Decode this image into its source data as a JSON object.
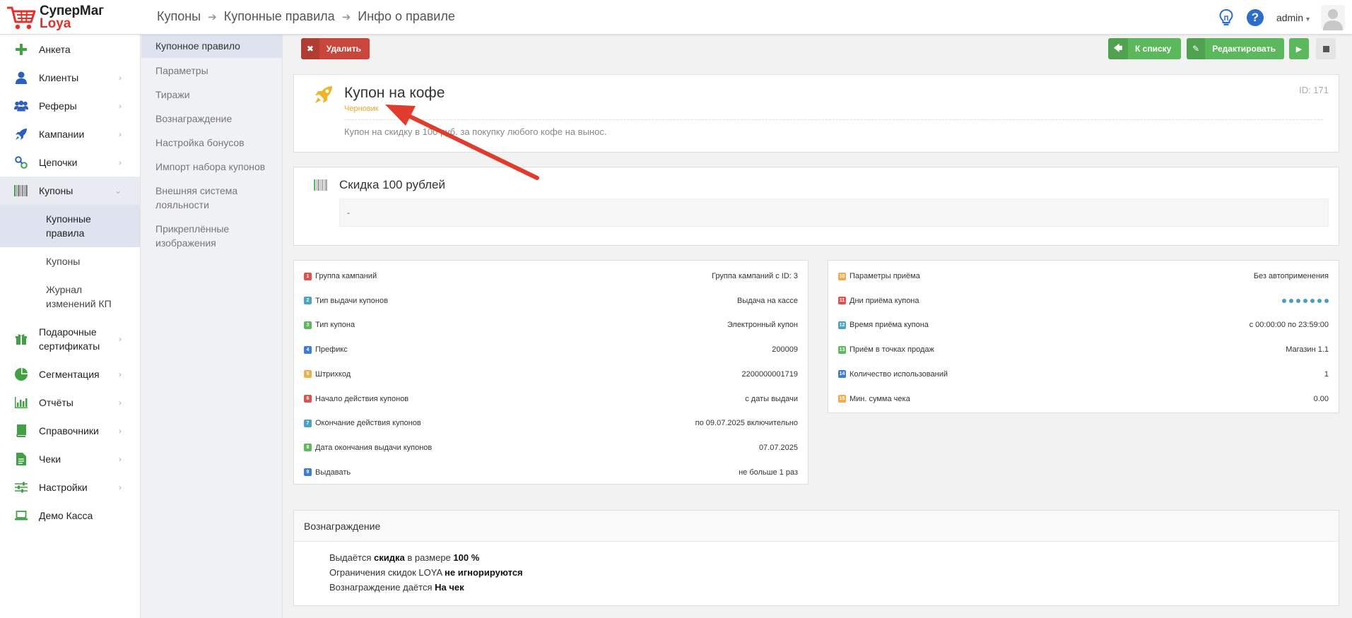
{
  "brand": {
    "name1": "СуперМаг",
    "name2": "Loya"
  },
  "breadcrumb": [
    "Купоны",
    "Купонные правила",
    "Инфо о правиле"
  ],
  "user": {
    "name": "admin"
  },
  "sidebar": {
    "items": [
      {
        "label": "Анкета",
        "icon": "plus-icon"
      },
      {
        "label": "Клиенты",
        "icon": "user-icon"
      },
      {
        "label": "Реферы",
        "icon": "users-icon"
      },
      {
        "label": "Кампании",
        "icon": "rocket-icon"
      },
      {
        "label": "Цепочки",
        "icon": "link-icon"
      },
      {
        "label": "Купоны",
        "icon": "barcode-icon"
      },
      {
        "label": "Подарочные сертификаты",
        "icon": "gift-icon"
      },
      {
        "label": "Сегментация",
        "icon": "pie-icon"
      },
      {
        "label": "Отчёты",
        "icon": "bar-chart-icon"
      },
      {
        "label": "Справочники",
        "icon": "book-icon"
      },
      {
        "label": "Чеки",
        "icon": "receipt-icon"
      },
      {
        "label": "Настройки",
        "icon": "sliders-icon"
      },
      {
        "label": "Демо Касса",
        "icon": "laptop-icon"
      }
    ],
    "coupons_sub": [
      "Купонные правила",
      "Купоны",
      "Журнал изменений КП"
    ]
  },
  "submenu": [
    "Купонное правило",
    "Параметры",
    "Тиражи",
    "Вознаграждение",
    "Настройка бонусов",
    "Импорт набора купонов",
    "Внешняя система лояльности",
    "Прикреплённые изображения"
  ],
  "toolbar": {
    "delete": "Удалить",
    "to_list": "К списку",
    "edit": "Редактировать"
  },
  "rule": {
    "title": "Купон на кофе",
    "status": "Черновик",
    "id": "ID: 171",
    "description": "Купон на скидку в 100 руб. за покупку любого кофе на вынос."
  },
  "coupon": {
    "title": "Скидка 100 рублей",
    "body": "-"
  },
  "params_left": [
    {
      "n": "1",
      "label": "Группа кампаний",
      "value": "Группа кампаний с ID: 3",
      "color": "#d9534f"
    },
    {
      "n": "2",
      "label": "Тип выдачи купонов",
      "value": "Выдача на кассе",
      "color": "#4aa3c3"
    },
    {
      "n": "3",
      "label": "Тип купона",
      "value": "Электронный купон",
      "color": "#5cb85c"
    },
    {
      "n": "4",
      "label": "Префикс",
      "value": "200009",
      "color": "#3b7dd8"
    },
    {
      "n": "5",
      "label": "Штрихкод",
      "value": "2200000001719",
      "color": "#f0ad4e"
    },
    {
      "n": "6",
      "label": "Начало действия купонов",
      "value": "с даты выдачи",
      "color": "#d9534f"
    },
    {
      "n": "7",
      "label": "Окончание действия купонов",
      "value": "по 09.07.2025 включительно",
      "color": "#4aa3c3"
    },
    {
      "n": "8",
      "label": "Дата окончания выдачи купонов",
      "value": "07.07.2025",
      "color": "#5cb85c"
    },
    {
      "n": "9",
      "label": "Выдавать",
      "value": "не больше 1 раз",
      "color": "#3b7dd8"
    }
  ],
  "params_right": [
    {
      "n": "10",
      "label": "Параметры приёма",
      "value": "Без автоприменения",
      "color": "#f0ad4e"
    },
    {
      "n": "11",
      "label": "Дни приёма купона",
      "value": "",
      "color": "#d9534f"
    },
    {
      "n": "12",
      "label": "Время приёма купона",
      "value": "с 00:00:00 по 23:59:00",
      "color": "#4aa3c3"
    },
    {
      "n": "13",
      "label": "Приём в точках продаж",
      "value": "Магазин 1.1",
      "color": "#5cb85c"
    },
    {
      "n": "14",
      "label": "Количество использований",
      "value": "1",
      "color": "#3b7dd8"
    },
    {
      "n": "15",
      "label": "Мин. сумма чека",
      "value": "0.00",
      "color": "#f0ad4e"
    }
  ],
  "reward": {
    "title": "Вознаграждение",
    "l1a": "Выдаётся ",
    "l1b": "скидка",
    "l1c": " в размере ",
    "l1d": "100 %",
    "l2a": "Ограничения скидок LOYA ",
    "l2b": "не игнорируются",
    "l3a": "Вознаграждение даётся ",
    "l3b": "На чек"
  }
}
